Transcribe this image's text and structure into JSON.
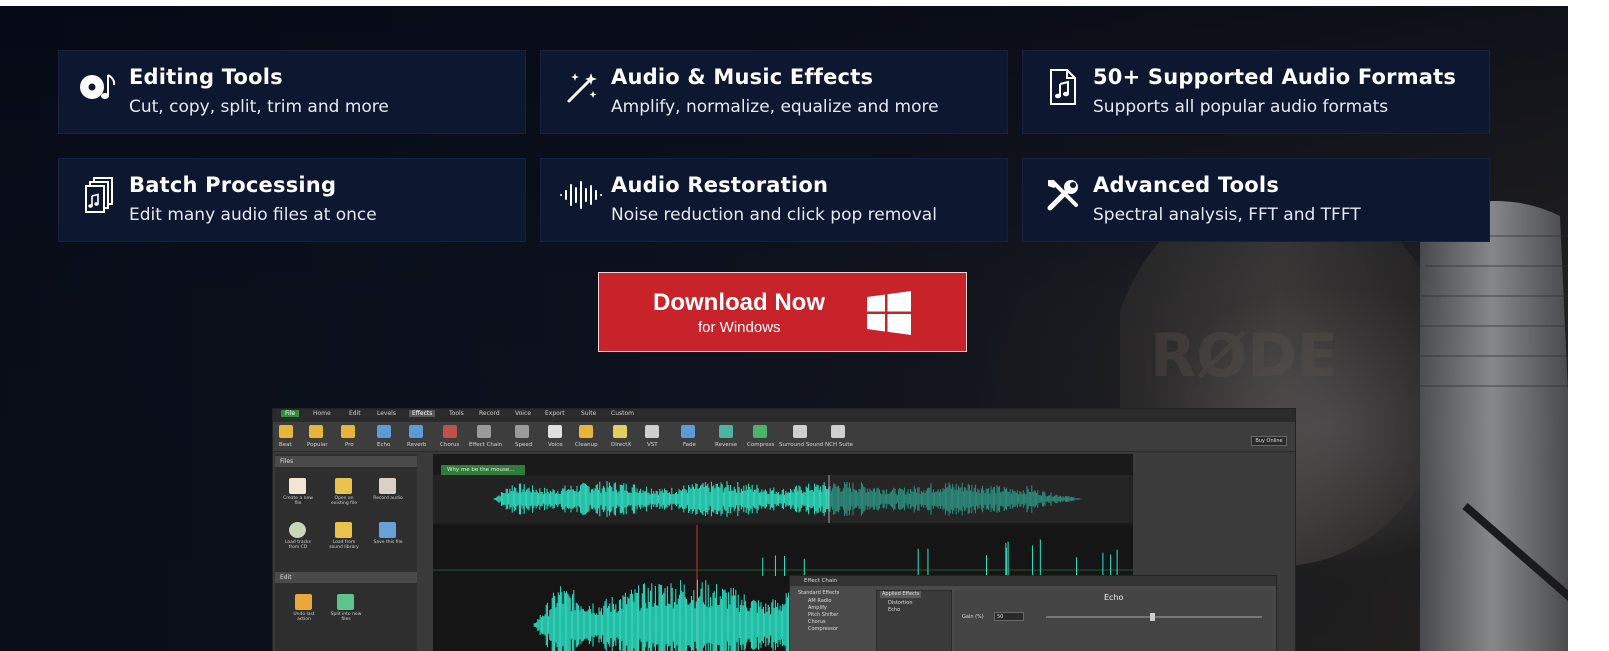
{
  "features": [
    {
      "icon": "cd-music-icon",
      "title": "Editing Tools",
      "subtitle": "Cut, copy, split, trim and more"
    },
    {
      "icon": "magic-wand-icon",
      "title": "Audio & Music Effects",
      "subtitle": "Amplify, normalize, equalize and more"
    },
    {
      "icon": "audio-file-icon",
      "title": "50+ Supported Audio Formats",
      "subtitle": "Supports all popular audio formats"
    },
    {
      "icon": "batch-files-icon",
      "title": "Batch Processing",
      "subtitle": "Edit many audio files at once"
    },
    {
      "icon": "waveform-icon",
      "title": "Audio Restoration",
      "subtitle": "Noise reduction and click pop removal"
    },
    {
      "icon": "tools-icon",
      "title": "Advanced Tools",
      "subtitle": "Spectral analysis, FFT and TFFT"
    }
  ],
  "download": {
    "label": "Download Now",
    "platform": "for Windows",
    "icon": "windows-logo-icon",
    "color": "#c8222b"
  },
  "colors": {
    "tile_bg": "#0d1730",
    "waveform": "#2ee6c8"
  },
  "app": {
    "tabs": [
      "File",
      "Home",
      "Edit",
      "Levels",
      "Effects",
      "Tools",
      "Record",
      "Voice",
      "Export",
      "Suite",
      "Custom"
    ],
    "ribbon": [
      "Beat",
      "Popular",
      "Pro",
      "Echo",
      "Reverb",
      "Chorus",
      "Effect Chain",
      "Speed",
      "Voice",
      "Cleanup",
      "DirectX",
      "VST",
      "Fade",
      "Reverse",
      "Compress",
      "Surround Sound",
      "NCH Suite"
    ],
    "buy_online": "Buy Online",
    "files_panel": "Files",
    "file_buttons": [
      "Create a new file",
      "Open an existing file",
      "Record audio",
      "Load tracks from CD",
      "Load from sound library",
      "Save this file"
    ],
    "edit_panel": "Edit",
    "edit_buttons": [
      "Undo last action",
      "Split into new files"
    ],
    "file_tab": "Why me be the mouse...",
    "effect_chain_title": "Effect Chain",
    "available_effects_header": "Standard Effects",
    "available_effects": [
      "AM Radio",
      "Amplify",
      "Pitch Shifter",
      "Chorus",
      "Compressor"
    ],
    "applied_effects_header": "Applied Effects",
    "applied_effects": [
      "Distortion",
      "Echo"
    ],
    "effect_name": "Echo",
    "gain_label": "Gain (%)",
    "gain_value": "50"
  }
}
